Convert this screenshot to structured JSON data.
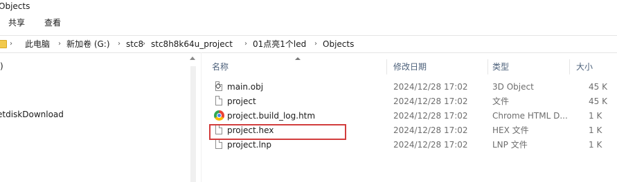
{
  "window": {
    "title": "Objects"
  },
  "ribbon": {
    "tabs": [
      "共享",
      "查看"
    ]
  },
  "address": {
    "breadcrumbs": [
      "此电脑",
      "新加卷 (G:)",
      "stc8",
      "stc8h8k64u_project",
      "01点亮1个led",
      "Objects"
    ],
    "separator": "›"
  },
  "nav": {
    "items": [
      ":)",
      "etdiskDownload"
    ]
  },
  "filelist": {
    "columns": {
      "name": "名称",
      "date": "修改日期",
      "type": "类型",
      "size": "大小"
    },
    "rows": [
      {
        "name": "main.obj",
        "date": "2024/12/28 17:02",
        "type": "3D Object",
        "size": "45 K",
        "icon": "obj-file-icon"
      },
      {
        "name": "project",
        "date": "2024/12/28 17:02",
        "type": "文件",
        "size": "45 K",
        "icon": "file-icon"
      },
      {
        "name": "project.build_log.htm",
        "date": "2024/12/28 17:02",
        "type": "Chrome HTML D...",
        "size": "1 K",
        "icon": "chrome-icon"
      },
      {
        "name": "project.hex",
        "date": "2024/12/28 17:02",
        "type": "HEX 文件",
        "size": "1 K",
        "icon": "file-icon"
      },
      {
        "name": "project.lnp",
        "date": "2024/12/28 17:02",
        "type": "LNP 文件",
        "size": "1 K",
        "icon": "file-icon"
      }
    ],
    "highlighted_row": "project.hex",
    "highlight_color": "#d23c3c"
  }
}
